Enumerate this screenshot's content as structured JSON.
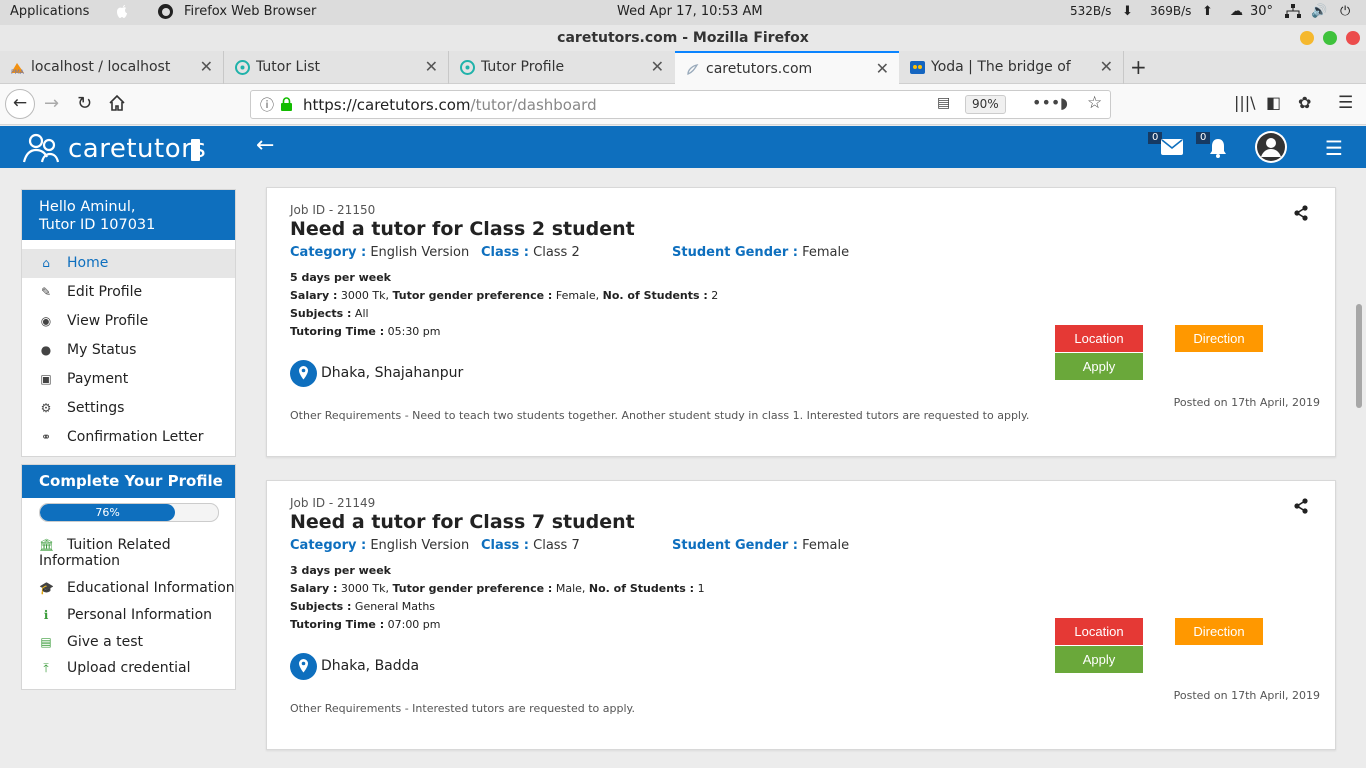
{
  "os": {
    "applications": "Applications",
    "app_name": "Firefox Web Browser",
    "clock": "Wed Apr 17, 10:53 AM",
    "net_down": "532B/s",
    "net_up": "369B/s",
    "temp": "30°"
  },
  "window": {
    "title": "caretutors.com - Mozilla Firefox"
  },
  "tabs": [
    {
      "label": "localhost / localhost | ph",
      "icon": "pma-icon"
    },
    {
      "label": "Tutor List",
      "icon": "caretutors-icon"
    },
    {
      "label": "Tutor Profile",
      "icon": "caretutors-icon"
    },
    {
      "label": "caretutors.com",
      "icon": "page-icon"
    },
    {
      "label": "Yoda | The bridge of Lear",
      "icon": "yoda-icon"
    }
  ],
  "urlbar": {
    "host": "https://caretutors.com",
    "path": "/tutor/dashboard",
    "zoom": "90%"
  },
  "site": {
    "logo": "caretutors",
    "mail_count": "0",
    "notif_count": "0"
  },
  "sidebar": {
    "greeting": "Hello Aminul,",
    "tutor_id": "Tutor ID 107031",
    "items": [
      {
        "label": "Home",
        "icon": "home-icon"
      },
      {
        "label": "Edit Profile",
        "icon": "edit-icon"
      },
      {
        "label": "View Profile",
        "icon": "eye-icon"
      },
      {
        "label": "My Status",
        "icon": "user-icon"
      },
      {
        "label": "Payment",
        "icon": "money-icon"
      },
      {
        "label": "Settings",
        "icon": "gear-icon"
      },
      {
        "label": "Confirmation Letter",
        "icon": "link-icon"
      }
    ]
  },
  "profile": {
    "title": "Complete Your Profile",
    "progress_label": "76%",
    "progress": 0.76,
    "items": [
      {
        "label": "Tuition Related Information",
        "icon": "bank-icon"
      },
      {
        "label": "Educational Information",
        "icon": "graduation-cap-icon"
      },
      {
        "label": "Personal Information",
        "icon": "info-icon"
      },
      {
        "label": "Give a test",
        "icon": "file-icon"
      },
      {
        "label": "Upload credential",
        "icon": "upload-icon"
      }
    ]
  },
  "jobs": [
    {
      "job_id": "Job ID - 21150",
      "title": "Need a tutor for Class 2 student",
      "category_label": "Category :",
      "category": "English Version",
      "class_label": "Class :",
      "class": "Class 2",
      "gender_label": "Student Gender :",
      "gender": "Female",
      "days": "5 days per week",
      "salary_label": "Salary :",
      "salary": "3000 Tk,",
      "tgp_label": "Tutor gender preference :",
      "tgp": "Female,",
      "students_label": "No. of Students :",
      "students": "2",
      "subjects_label": "Subjects :",
      "subjects": "All",
      "time_label": "Tutoring Time :",
      "time": "05:30 pm",
      "location": "Dhaka, Shajahanpur",
      "location_btn": "Location",
      "direction_btn": "Direction",
      "apply_btn": "Apply",
      "posted": "Posted on 17th April, 2019",
      "other": "Other Requirements - Need to teach two students together. Another student study in class 1. Interested tutors are requested to apply."
    },
    {
      "job_id": "Job ID - 21149",
      "title": "Need a tutor for Class 7 student",
      "category_label": "Category :",
      "category": "English Version",
      "class_label": "Class :",
      "class": "Class 7",
      "gender_label": "Student Gender :",
      "gender": "Female",
      "days": "3 days per week",
      "salary_label": "Salary :",
      "salary": "3000 Tk,",
      "tgp_label": "Tutor gender preference :",
      "tgp": "Male,",
      "students_label": "No. of Students :",
      "students": "1",
      "subjects_label": "Subjects :",
      "subjects": "General Maths",
      "time_label": "Tutoring Time :",
      "time": "07:00 pm",
      "location": "Dhaka, Badda",
      "location_btn": "Location",
      "direction_btn": "Direction",
      "apply_btn": "Apply",
      "posted": "Posted on 17th April, 2019",
      "other": "Other Requirements - Interested tutors are requested to apply."
    }
  ]
}
